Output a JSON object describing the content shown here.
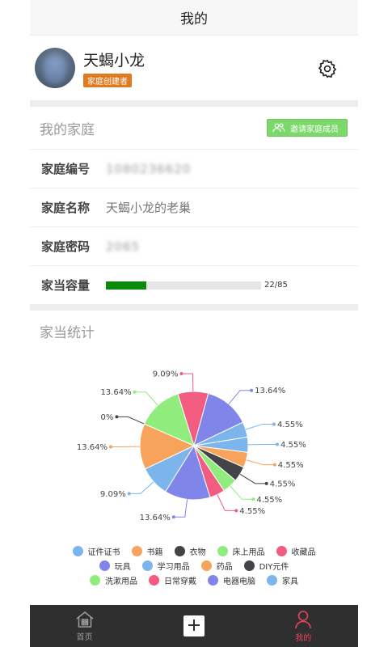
{
  "header": {
    "title": "我的"
  },
  "profile": {
    "username": "天蝎小龙",
    "role": "家庭创建者"
  },
  "family": {
    "section_title": "我的家庭",
    "invite_label": "邀请家庭成员",
    "rows": [
      {
        "label": "家庭编号",
        "value": "1080236620"
      },
      {
        "label": "家庭名称",
        "value": "天蝎小龙的老巢"
      },
      {
        "label": "家庭密码",
        "value": "2065"
      }
    ],
    "capacity": {
      "label": "家当容量",
      "used": 22,
      "total": 85,
      "text": "22/85",
      "fill_color": "#0a8a0a"
    }
  },
  "stats": {
    "section_title": "家当统计"
  },
  "chart_data": {
    "type": "pie",
    "slices": [
      {
        "name": "证件证书",
        "value": 4.55,
        "color": "#7cb5ec",
        "label": "4.55%"
      },
      {
        "name": "书籍",
        "value": 4.55,
        "color": "#f7a35c",
        "label": "4.55%"
      },
      {
        "name": "衣物",
        "value": 4.55,
        "color": "#434348",
        "label": "4.55%"
      },
      {
        "name": "床上用品",
        "value": 4.55,
        "color": "#90ed7d",
        "label": "4.55%"
      },
      {
        "name": "收藏品",
        "value": 4.55,
        "color": "#f15c80",
        "label": "4.55%"
      },
      {
        "name": "玩具",
        "value": 13.64,
        "color": "#8085e9",
        "label": "13.64%"
      },
      {
        "name": "学习用品",
        "value": 9.09,
        "color": "#7cb5ec",
        "label": "9.09%"
      },
      {
        "name": "药品",
        "value": 13.64,
        "color": "#f7a35c",
        "label": "13.64%"
      },
      {
        "name": "DIY元件",
        "value": 0,
        "color": "#434348",
        "label": "0%"
      },
      {
        "name": "洗漱用品",
        "value": 13.64,
        "color": "#90ed7d",
        "label": "13.64%"
      },
      {
        "name": "日常穿戴",
        "value": 9.09,
        "color": "#f15c80",
        "label": "9.09%"
      },
      {
        "name": "电器电脑",
        "value": 13.64,
        "color": "#8085e9",
        "label": "13.64%"
      },
      {
        "name": "家具",
        "value": 4.55,
        "color": "#7cb5ec",
        "label": "4.55%"
      }
    ],
    "legend_placement": "bottom"
  },
  "tabbar": {
    "items": [
      {
        "label": "首页",
        "icon": "home-icon"
      },
      {
        "label": "",
        "icon": "add-icon"
      },
      {
        "label": "我的",
        "icon": "user-icon"
      }
    ]
  }
}
